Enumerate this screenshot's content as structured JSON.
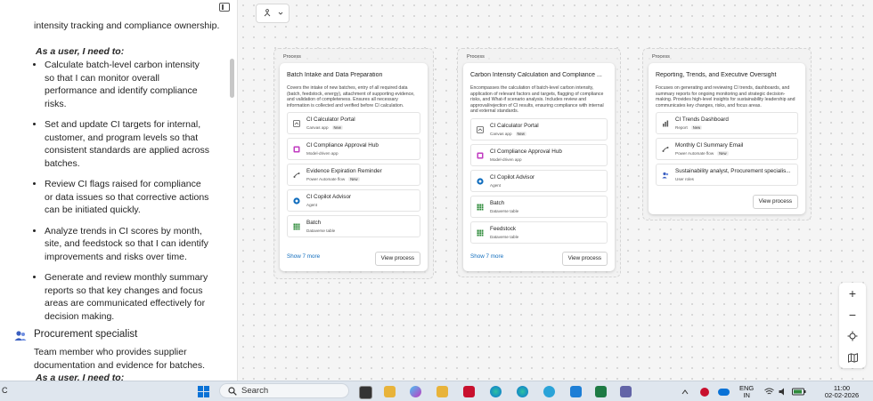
{
  "left_panel": {
    "intro_text": "intensity tracking and compliance ownership.",
    "need_label": "As a user, I need to:",
    "needs": [
      "Calculate batch-level carbon intensity so that I can monitor overall performance and identify compliance risks.",
      "Set and update CI targets for internal, customer, and program levels so that consistent standards are applied across batches.",
      "Review CI flags raised for compliance or data issues so that corrective actions can be initiated quickly.",
      "Analyze trends in CI scores by month, site, and feedstock so that I can identify improvements and risks over time.",
      "Generate and review monthly summary reports so that key changes and focus areas are communicated effectively for decision making."
    ],
    "role": {
      "title": "Procurement specialist",
      "description": "Team member who provides supplier documentation and evidence for batches.",
      "need_label": "As a user, I need to:"
    }
  },
  "canvas": {
    "processes": [
      {
        "label": "Process",
        "title": "Batch Intake and Data Preparation",
        "description": "Covers the intake of new batches, entry of all required data (batch, feedstock, energy), attachment of supporting evidence, and validation of completeness. Ensures all necessary information is collected and verified before CI calculation.",
        "items": [
          {
            "name": "CI Calculator Portal",
            "type": "Canvas app",
            "new": "New",
            "icon": "canvas-app-icon"
          },
          {
            "name": "CI Compliance Approval Hub",
            "type": "Model-driven app",
            "new": "",
            "icon": "model-driven-app-icon"
          },
          {
            "name": "Evidence Expiration Reminder",
            "type": "Power Automate flow",
            "new": "New",
            "icon": "flow-icon"
          },
          {
            "name": "CI Copilot Advisor",
            "type": "Agent",
            "new": "",
            "icon": "agent-icon"
          },
          {
            "name": "Batch",
            "type": "Dataverse table",
            "new": "",
            "icon": "table-icon"
          }
        ],
        "show_more": "Show 7 more",
        "view_button": "View process"
      },
      {
        "label": "Process",
        "title": "Carbon Intensity Calculation and Compliance ...",
        "description": "Encompasses the calculation of batch-level carbon intensity, application of relevant factors and targets, flagging of compliance risks, and What-if scenario analysis. Includes review and approval/rejection of CI results, ensuring compliance with internal and external standards.",
        "items": [
          {
            "name": "CI Calculator Portal",
            "type": "Canvas app",
            "new": "New",
            "icon": "canvas-app-icon"
          },
          {
            "name": "CI Compliance Approval Hub",
            "type": "Model-driven app",
            "new": "",
            "icon": "model-driven-app-icon"
          },
          {
            "name": "CI Copilot Advisor",
            "type": "Agent",
            "new": "",
            "icon": "agent-icon"
          },
          {
            "name": "Batch",
            "type": "Dataverse table",
            "new": "",
            "icon": "table-icon"
          },
          {
            "name": "Feedstock",
            "type": "Dataverse table",
            "new": "",
            "icon": "table-icon"
          }
        ],
        "show_more": "Show 7 more",
        "view_button": "View process"
      },
      {
        "label": "Process",
        "title": "Reporting, Trends, and Executive Oversight",
        "description": "Focuses on generating and reviewing CI trends, dashboards, and summary reports for ongoing monitoring and strategic decision-making. Provides high-level insights for sustainability leadership and communicates key changes, risks, and focus areas.",
        "items": [
          {
            "name": "CI Trends Dashboard",
            "type": "Report",
            "new": "New",
            "icon": "report-icon"
          },
          {
            "name": "Monthly CI Summary Email",
            "type": "Power Automate flow",
            "new": "New",
            "icon": "flow-icon"
          },
          {
            "name": "Sustainability analyst, Procurement specialis...",
            "type": "User roles",
            "new": "",
            "icon": "user-roles-icon"
          }
        ],
        "show_more": "",
        "view_button": "View process"
      }
    ],
    "zoom": {
      "in": "+",
      "out": "−"
    }
  },
  "taskbar": {
    "search_label": "Search",
    "lang_top": "ENG",
    "lang_bottom": "IN",
    "time": "11:00",
    "date": "02-02-2026",
    "left_char": "C"
  }
}
